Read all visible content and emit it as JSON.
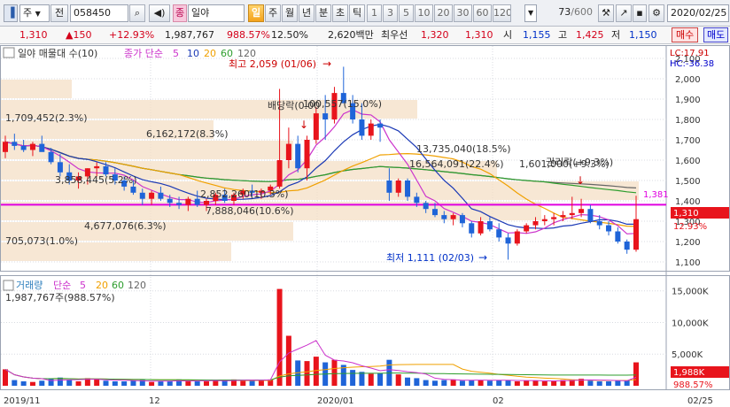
{
  "toolbar": {
    "type_select": "주",
    "type_select2": "전",
    "code": "058450",
    "name_tag": "종",
    "stock_name": "일야",
    "periods": [
      "일",
      "주",
      "월",
      "년",
      "분",
      "초",
      "틱"
    ],
    "active_period": "일",
    "intervals": [
      "1",
      "3",
      "5",
      "10",
      "20",
      "30",
      "60",
      "120"
    ],
    "count": "73",
    "total": "/600",
    "date": "2020/02/25"
  },
  "quote": {
    "price": "1,310",
    "change": "150",
    "change_pct": "+12.93%",
    "volume": "1,987,767",
    "volume_pct": "988.57%",
    "turnover_pct": "12.50%",
    "amount": "2,620백만",
    "best_label": "최우선",
    "bid1": "1,320",
    "bid2": "1,310",
    "open_label": "시",
    "open": "1,155",
    "high_label": "고",
    "high": "1,425",
    "low_label": "저",
    "low": "1,150",
    "buy_label": "매수",
    "sell_label": "매도"
  },
  "price_panel": {
    "legend_title": "일야 매물대 수(10)",
    "legend_ma": "종가 단순",
    "ma_periods": [
      "5",
      "10",
      "20",
      "60",
      "120"
    ],
    "lc": "LC:17.91",
    "hc": "HC:-36.38",
    "high_note": "최고 2,059 (01/06)",
    "low_note": "최저 1,111 (02/03)",
    "dividend_note": "배당락(0.00",
    "rights_note": "권리락(+9.3%)",
    "hline_label": "1,381",
    "current_price": "1,310",
    "current_pct": "12.93%",
    "profile_labels": [
      "1,709,452(2.3%)",
      "6,162,172(8.3%)",
      "100,557(15.0%)",
      "13,735,040(18.5%)",
      "16,564,091(22.4%)",
      "1,601,000(+9.3%)",
      "3,858,445(5.2%)",
      "2,852,260(10.3%)",
      "7,888,046(10.6%)",
      "4,677,076(6.3%)",
      "705,073(1.0%)"
    ]
  },
  "volume_panel": {
    "legend_title": "거래량",
    "legend_ma": "단순",
    "ma_periods": [
      "5",
      "20",
      "60",
      "120"
    ],
    "volume_text": "1,987,767주(988.57%)",
    "current_volume": "1,988K",
    "current_pct": "988.57%"
  },
  "x_axis_labels": [
    "2019/11",
    "12",
    "2020/01",
    "02",
    "02/25"
  ],
  "colors": {
    "up": "#e8141c",
    "down": "#1f64d8",
    "ma5": "#cc33cc",
    "ma10": "#1b39b5",
    "ma20": "#f0a000",
    "ma60": "#2d9d2d",
    "ma120": "#666666",
    "hline": "#e000e0",
    "profile": "#f4dfc6"
  },
  "chart_data": {
    "type": "candlestick",
    "y_range": [
      1100,
      2100
    ],
    "y_ticks": [
      "2,100",
      "2,000",
      "1,900",
      "1,800",
      "1,700",
      "1,600",
      "1,500",
      "1,400",
      "1,300",
      "1,200",
      "1,100"
    ],
    "volume_ticks": [
      "15,000K",
      "10,000K",
      "5,000K"
    ],
    "volume_range_k": [
      0,
      16500
    ],
    "hline": 1381,
    "candles": [
      [
        1640,
        1720,
        1610,
        1690
      ],
      [
        1690,
        1730,
        1650,
        1670
      ],
      [
        1670,
        1700,
        1640,
        1650
      ],
      [
        1650,
        1690,
        1620,
        1680
      ],
      [
        1680,
        1720,
        1650,
        1640
      ],
      [
        1640,
        1660,
        1580,
        1590
      ],
      [
        1590,
        1630,
        1520,
        1540
      ],
      [
        1540,
        1580,
        1480,
        1500
      ],
      [
        1500,
        1540,
        1460,
        1520
      ],
      [
        1520,
        1560,
        1480,
        1560
      ],
      [
        1560,
        1590,
        1520,
        1570
      ],
      [
        1570,
        1590,
        1520,
        1530
      ],
      [
        1530,
        1560,
        1480,
        1500
      ],
      [
        1500,
        1520,
        1450,
        1470
      ],
      [
        1470,
        1500,
        1430,
        1440
      ],
      [
        1440,
        1460,
        1380,
        1410
      ],
      [
        1410,
        1450,
        1380,
        1440
      ],
      [
        1440,
        1470,
        1400,
        1410
      ],
      [
        1410,
        1430,
        1370,
        1390
      ],
      [
        1390,
        1420,
        1360,
        1380
      ],
      [
        1380,
        1420,
        1350,
        1410
      ],
      [
        1410,
        1450,
        1370,
        1380
      ],
      [
        1380,
        1410,
        1350,
        1400
      ],
      [
        1400,
        1440,
        1380,
        1430
      ],
      [
        1430,
        1460,
        1390,
        1400
      ],
      [
        1400,
        1440,
        1380,
        1430
      ],
      [
        1430,
        1460,
        1410,
        1450
      ],
      [
        1450,
        1480,
        1420,
        1440
      ],
      [
        1440,
        1460,
        1410,
        1450
      ],
      [
        1450,
        1480,
        1430,
        1470
      ],
      [
        1470,
        1950,
        1460,
        1600
      ],
      [
        1600,
        1760,
        1560,
        1680
      ],
      [
        1680,
        1720,
        1540,
        1560
      ],
      [
        1560,
        1720,
        1500,
        1700
      ],
      [
        1700,
        1860,
        1680,
        1830
      ],
      [
        1830,
        1920,
        1700,
        1800
      ],
      [
        1800,
        1960,
        1780,
        1930
      ],
      [
        1930,
        2059,
        1880,
        1880
      ],
      [
        1880,
        1920,
        1780,
        1800
      ],
      [
        1800,
        1880,
        1700,
        1720
      ],
      [
        1720,
        1800,
        1700,
        1780
      ],
      [
        1780,
        1800,
        1690,
        1760
      ],
      [
        1500,
        1560,
        1400,
        1440
      ],
      [
        1440,
        1510,
        1420,
        1500
      ],
      [
        1500,
        1510,
        1400,
        1420
      ],
      [
        1420,
        1440,
        1370,
        1390
      ],
      [
        1390,
        1400,
        1340,
        1360
      ],
      [
        1360,
        1390,
        1320,
        1330
      ],
      [
        1330,
        1350,
        1290,
        1310
      ],
      [
        1310,
        1340,
        1280,
        1330
      ],
      [
        1330,
        1340,
        1270,
        1290
      ],
      [
        1290,
        1300,
        1220,
        1240
      ],
      [
        1240,
        1320,
        1230,
        1300
      ],
      [
        1300,
        1320,
        1250,
        1260
      ],
      [
        1260,
        1290,
        1200,
        1220
      ],
      [
        1220,
        1240,
        1111,
        1190
      ],
      [
        1190,
        1260,
        1180,
        1250
      ],
      [
        1250,
        1290,
        1240,
        1280
      ],
      [
        1280,
        1320,
        1260,
        1300
      ],
      [
        1300,
        1330,
        1280,
        1310
      ],
      [
        1310,
        1340,
        1280,
        1320
      ],
      [
        1320,
        1350,
        1300,
        1330
      ],
      [
        1330,
        1420,
        1310,
        1340
      ],
      [
        1340,
        1410,
        1320,
        1360
      ],
      [
        1360,
        1380,
        1290,
        1300
      ],
      [
        1300,
        1330,
        1260,
        1280
      ],
      [
        1280,
        1300,
        1230,
        1250
      ],
      [
        1250,
        1270,
        1190,
        1200
      ],
      [
        1200,
        1210,
        1140,
        1160
      ],
      [
        1160,
        1425,
        1150,
        1310
      ]
    ],
    "volumes_k": [
      2600,
      900,
      700,
      600,
      800,
      1100,
      1300,
      900,
      700,
      1200,
      1100,
      800,
      700,
      700,
      800,
      900,
      600,
      700,
      700,
      1000,
      800,
      700,
      700,
      900,
      800,
      1000,
      900,
      900,
      800,
      1000,
      15300,
      7900,
      4000,
      3900,
      4600,
      3700,
      4100,
      3300,
      2500,
      2200,
      1900,
      2000,
      4100,
      1800,
      1300,
      1200,
      900,
      800,
      900,
      1000,
      800,
      900,
      900,
      800,
      900,
      900,
      700,
      800,
      800,
      700,
      800,
      900,
      1000,
      1100,
      800,
      700,
      700,
      800,
      900,
      3700
    ],
    "volume_up": [
      true,
      false,
      false,
      true,
      false,
      false,
      false,
      false,
      true,
      true,
      true,
      false,
      false,
      false,
      false,
      false,
      true,
      false,
      false,
      false,
      true,
      false,
      true,
      true,
      false,
      true,
      true,
      false,
      true,
      true,
      true,
      true,
      false,
      true,
      true,
      false,
      true,
      false,
      false,
      false,
      true,
      false,
      false,
      true,
      false,
      false,
      false,
      false,
      false,
      true,
      false,
      false,
      true,
      false,
      false,
      false,
      true,
      true,
      true,
      true,
      true,
      true,
      true,
      true,
      false,
      false,
      false,
      false,
      false,
      true
    ]
  }
}
